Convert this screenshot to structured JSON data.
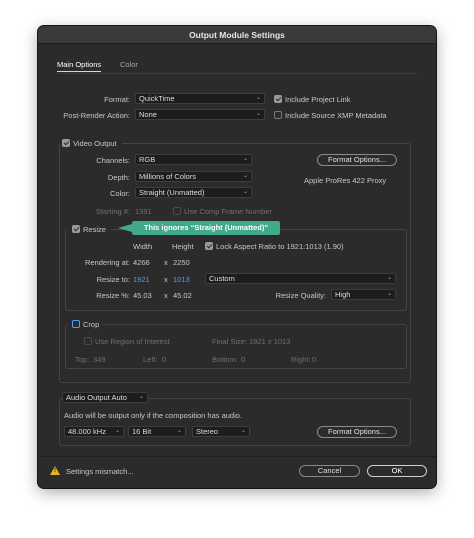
{
  "window": {
    "title": "Output Module Settings"
  },
  "tabs": {
    "main": "Main Options",
    "color": "Color"
  },
  "format": {
    "format_label": "Format:",
    "format_value": "QuickTime",
    "post_render_label": "Post-Render Action:",
    "post_render_value": "None",
    "include_project_link": "Include Project Link",
    "include_xmp": "Include Source XMP Metadata"
  },
  "video": {
    "video_output_label": "Video Output",
    "channels_label": "Channels:",
    "channels_value": "RGB",
    "depth_label": "Depth:",
    "depth_value": "Millions of Colors",
    "color_label": "Color:",
    "color_value": "Straight (Unmatted)",
    "starting_label": "Starting #:",
    "starting_value": "1391",
    "use_comp_frame": "Use Comp Frame Number",
    "format_options_button": "Format Options...",
    "codec_text": "Apple ProRes 422 Proxy"
  },
  "resize": {
    "resize_label": "Resize",
    "callout": "This ignores “Straight (Unmatted)”",
    "width_header": "Width",
    "height_header": "Height",
    "lock_aspect": "Lock Aspect Ratio to 1921:1013 (1.90)",
    "rendering_at_label": "Rendering at:",
    "rendering_w": "4266",
    "rendering_h": "2250",
    "x": "x",
    "resize_to_label": "Resize to:",
    "resize_to_w": "1921",
    "resize_to_h": "1013",
    "preset_value": "Custom",
    "resize_pct_label": "Resize %:",
    "resize_pct_w": "45.03",
    "resize_pct_h": "45.02",
    "quality_label": "Resize Quality:",
    "quality_value": "High"
  },
  "crop": {
    "crop_label": "Crop",
    "use_roi": "Use Region of Interest",
    "final_size": "Final Size: 1921 x 1013",
    "top_label": "Top:",
    "top_value": "349",
    "left_label": "Left:",
    "left_value": "0",
    "bottom_label": "Bottom:",
    "bottom_value": "0",
    "right_label": "Right:",
    "right_value": "0"
  },
  "audio": {
    "audio_output_value": "Audio Output Auto",
    "note": "Audio will be output only if the composition has audio.",
    "rate_value": "48.000 kHz",
    "bits_value": "16 Bit",
    "channels_value": "Stereo",
    "format_options_button": "Format Options..."
  },
  "footer": {
    "warning_text": "Settings mismatch...",
    "cancel_button": "Cancel",
    "ok_button": "OK"
  },
  "colors": {
    "accent_blue": "#4a9eff",
    "callout_green": "#3fa98a",
    "warning_yellow": "#e6b422"
  }
}
